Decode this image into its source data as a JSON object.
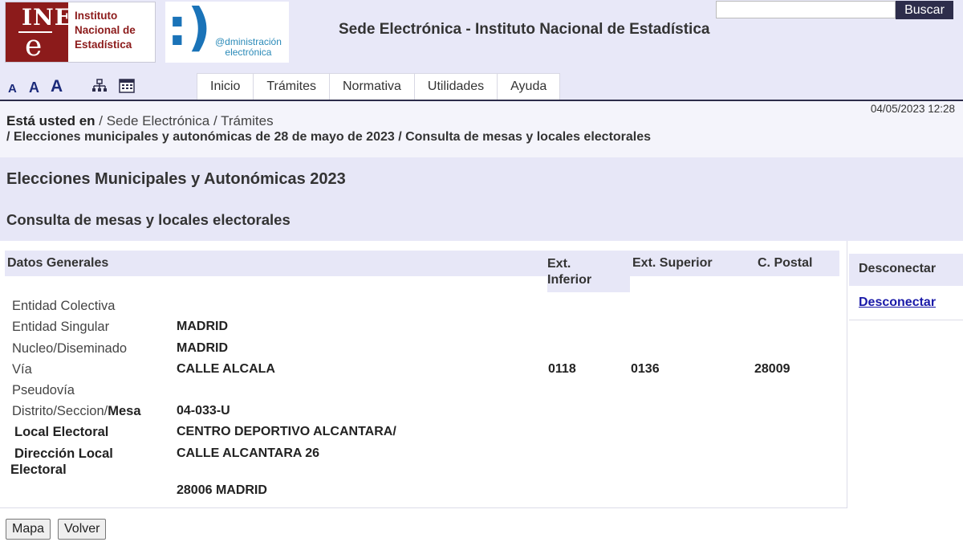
{
  "header": {
    "ine_logo_mark_top": "INE",
    "ine_logo_mark_e": "e",
    "ine_name_lines": [
      "Instituto",
      "Nacional de",
      "Estadística"
    ],
    "admin_logo_face": ":)",
    "admin_logo_text_lines": [
      "@dministración",
      "electrónica"
    ],
    "site_title": "Sede Electrónica - Instituto Nacional de Estadística",
    "search_placeholder": "",
    "search_button": "Buscar",
    "font_size_labels": [
      "A",
      "A",
      "A"
    ],
    "tools": [
      "sitemap-icon",
      "calendar-icon"
    ],
    "tabs": [
      "Inicio",
      "Trámites",
      "Normativa",
      "Utilidades",
      "Ayuda"
    ]
  },
  "breadcrumb": {
    "prefix": "Está usted en",
    "path1": " / Sede Electrónica / Trámites",
    "path2": "/ Elecciones municipales y autonómicas de 28 de mayo de 2023 / Consulta de mesas y locales electorales",
    "datetime": "04/05/2023 12:28"
  },
  "page": {
    "title": "Elecciones Municipales y Autonómicas 2023",
    "subtitle": "Consulta de mesas y locales electorales"
  },
  "table": {
    "headers": {
      "general": "Datos Generales",
      "ext_inferior": "Ext. Inferior",
      "ext_superior": "Ext. Superior",
      "postal": "C. Postal"
    },
    "rows": {
      "entidad_colectiva": {
        "label": "Entidad Colectiva",
        "value": ""
      },
      "entidad_singular": {
        "label": "Entidad Singular",
        "value": "MADRID"
      },
      "nucleo": {
        "label": "Nucleo/Diseminado",
        "value": "MADRID"
      },
      "via": {
        "label": "Vía",
        "value": "CALLE ALCALA",
        "ext_inferior": "0118",
        "ext_superior": "0136",
        "postal": "28009"
      },
      "pseudovia": {
        "label": "Pseudovía",
        "value": ""
      },
      "distrito": {
        "label": "Distrito/Seccion/",
        "label_bold": "Mesa",
        "value": "04-033-U"
      },
      "local": {
        "label": "Local Electoral",
        "value": "CENTRO DEPORTIVO ALCANTARA/"
      },
      "direccion": {
        "label_line1": "Dirección Local",
        "label_line2": "Electoral",
        "value": "CALLE ALCANTARA 26",
        "value2": "28006 MADRID"
      }
    }
  },
  "sidebar": {
    "heading": "Desconectar",
    "link": "Desconectar"
  },
  "buttons": {
    "map": "Mapa",
    "back": "Volver"
  }
}
